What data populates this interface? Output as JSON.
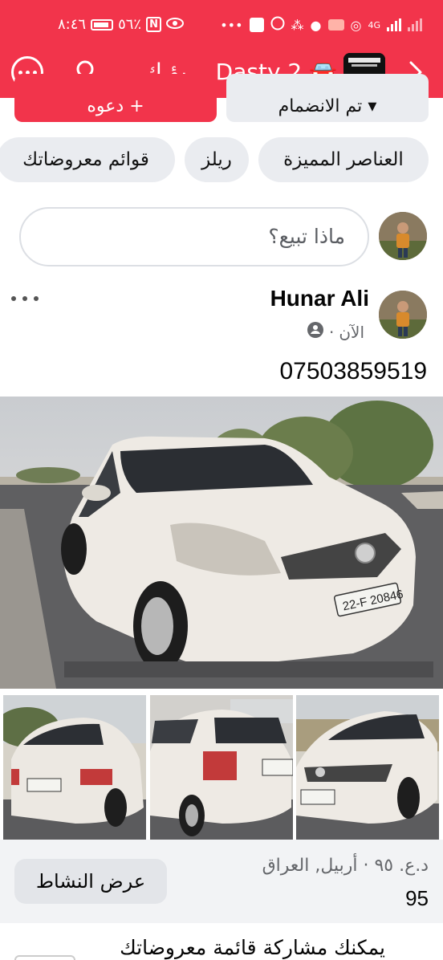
{
  "status_bar": {
    "time": "٨:٤٦",
    "battery_percent": "٥٦٪",
    "network": "4G"
  },
  "header": {
    "group_title": "بؤ ك... Dasty 2 🚘",
    "more_icon": "more-horizontal-circle-icon",
    "search_icon": "search-icon",
    "next_icon": "chevron-right-icon",
    "accent_color": "#f2344b"
  },
  "actions": {
    "invite_label": "دعوه",
    "joined_label": "تم الانضمام"
  },
  "chips": [
    {
      "label": "العناصر المميزة"
    },
    {
      "label": "ريلز"
    },
    {
      "label": "قوائم معروضاتك"
    }
  ],
  "composer": {
    "placeholder": "ماذا تبيع؟"
  },
  "post": {
    "author": "Hunar Ali",
    "time": "الآن",
    "privacy_icon": "group-audience-icon",
    "body": "07503859519",
    "plate_text": "22-F 20846"
  },
  "listing": {
    "location": "د.ع. ٩٥ · أربيل, العراق",
    "price": "95",
    "activity_button": "عرض النشاط"
  },
  "share": {
    "text": "يمكنك مشاركة قائمة معروضاتك"
  }
}
